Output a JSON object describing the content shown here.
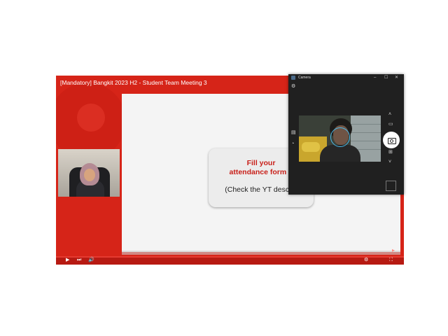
{
  "video": {
    "title": "[Mandatory] Bangkit 2023 H2 - Student Team Meeting 3",
    "callout_line1": "Fill your",
    "callout_line2": "attendance form n",
    "callout_line3": "(Check the YT descrip"
  },
  "camera_app": {
    "title": "Camera",
    "window_minimize": "–",
    "window_maximize": "☐",
    "window_close": "✕",
    "icons": [
      "settings-icon",
      "photo-mode-icon",
      "timer-icon",
      "chevron-up-icon",
      "video-mode-icon",
      "shutter-icon",
      "grid-icon",
      "chevron-down-icon"
    ]
  },
  "controls": {
    "play": "▶",
    "next": "⏭",
    "volume": "🔊",
    "settings": "⚙",
    "fullscreen": "⛶"
  },
  "colors": {
    "brand_red": "#d62418",
    "focus_ring": "#49b8e8",
    "camera_bg": "#202020"
  }
}
